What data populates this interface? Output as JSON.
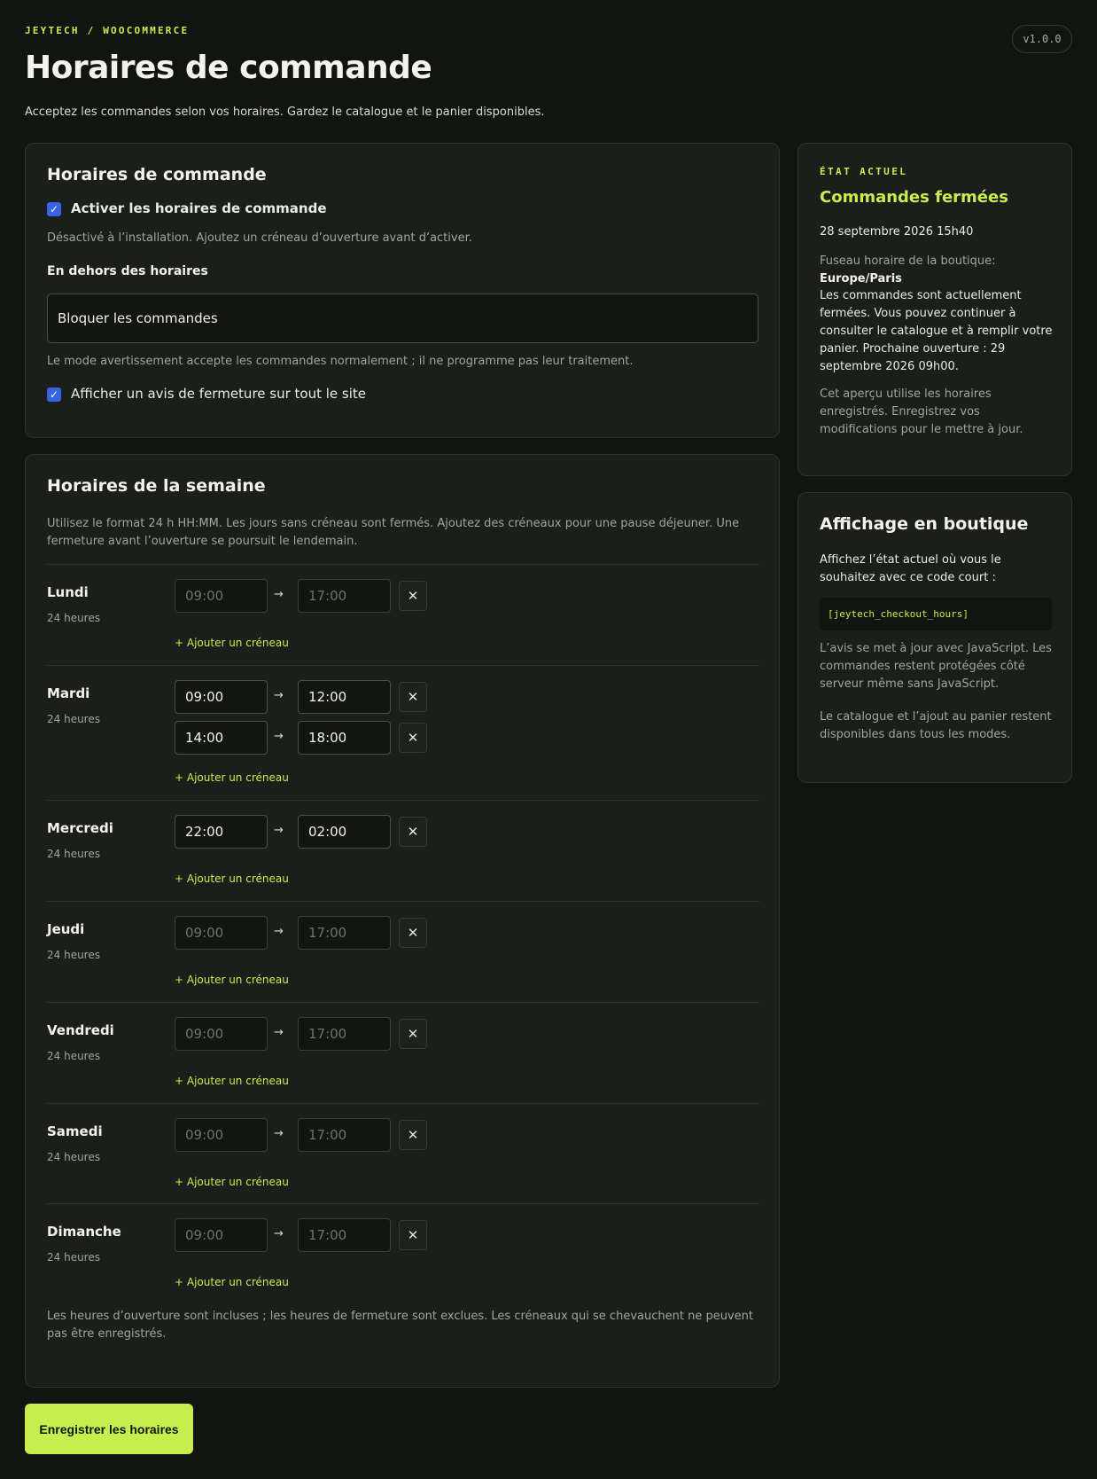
{
  "header": {
    "eyebrow": "JEYTECH / WOOCOMMERCE",
    "version": "v1.0.0",
    "title": "Horaires de commande",
    "subtitle": "Acceptez les commandes selon vos horaires. Gardez le catalogue et le panier disponibles."
  },
  "settings": {
    "title": "Horaires de commande",
    "enable_label": "Activer les horaires de commande",
    "enable_checked": true,
    "enable_help": "Désactivé à l’installation. Ajoutez un créneau d’ouverture avant d’activer.",
    "outside_label": "En dehors des horaires",
    "outside_value": "Bloquer les commandes",
    "outside_help": "Le mode avertissement accepte les commandes normalement ; il ne programme pas leur traitement.",
    "notice_label": "Afficher un avis de fermeture sur tout le site",
    "notice_checked": true
  },
  "week": {
    "title": "Horaires de la semaine",
    "description": "Utilisez le format 24 h HH:MM. Les jours sans créneau sont fermés. Ajoutez des créneaux pour une pause déjeuner. Une fermeture avant l’ouverture se poursuit le lendemain.",
    "arrow": "→",
    "remove_icon": "✕",
    "add_slot_label": "+ Ajouter un créneau",
    "days": [
      {
        "name": "Lundi",
        "hours": "24 heures",
        "slots": [
          {
            "from": "",
            "to": "",
            "from_ph": "09:00",
            "to_ph": "17:00"
          }
        ]
      },
      {
        "name": "Mardi",
        "hours": "24 heures",
        "slots": [
          {
            "from": "09:00",
            "to": "12:00"
          },
          {
            "from": "14:00",
            "to": "18:00"
          }
        ]
      },
      {
        "name": "Mercredi",
        "hours": "24 heures",
        "slots": [
          {
            "from": "22:00",
            "to": "02:00"
          }
        ]
      },
      {
        "name": "Jeudi",
        "hours": "24 heures",
        "slots": [
          {
            "from": "",
            "to": "",
            "from_ph": "09:00",
            "to_ph": "17:00"
          }
        ]
      },
      {
        "name": "Vendredi",
        "hours": "24 heures",
        "slots": [
          {
            "from": "",
            "to": "",
            "from_ph": "09:00",
            "to_ph": "17:00"
          }
        ]
      },
      {
        "name": "Samedi",
        "hours": "24 heures",
        "slots": [
          {
            "from": "",
            "to": "",
            "from_ph": "09:00",
            "to_ph": "17:00"
          }
        ]
      },
      {
        "name": "Dimanche",
        "hours": "24 heures",
        "slots": [
          {
            "from": "",
            "to": "",
            "from_ph": "09:00",
            "to_ph": "17:00"
          }
        ]
      }
    ],
    "footer": "Les heures d’ouverture sont incluses ; les heures de fermeture sont exclues. Les créneaux qui se chevauchent ne peuvent pas être enregistrés."
  },
  "save_label": "Enregistrer les horaires",
  "status": {
    "eyebrow": "ÉTAT ACTUEL",
    "title": "Commandes fermées",
    "datetime": "28 septembre 2026 15h40",
    "timezone_label": "Fuseau horaire de la boutique: ",
    "timezone_value": "Europe/Paris",
    "message": "Les commandes sont actuellement fermées. Vous pouvez continuer à consulter le catalogue et à remplir votre panier. Prochaine ouverture : 29 septembre 2026 09h00.",
    "preview_note": "Cet aperçu utilise les horaires enregistrés. Enregistrez vos modifications pour le mettre à jour."
  },
  "display": {
    "title": "Affichage en boutique",
    "intro": "Affichez l’état actuel où vous le souhaitez avec ce code court :",
    "shortcode": "[jeytech_checkout_hours]",
    "js_note": "L’avis se met à jour avec JavaScript. Les commandes restent protégées côté serveur même sans JavaScript.",
    "catalog_note": "Le catalogue et l’ajout au panier restent disponibles dans tous les modes."
  },
  "colors": {
    "background": "#121412",
    "card": "#1b1e1a",
    "accent": "#c6ef4e",
    "checkbox": "#3a63e6"
  }
}
